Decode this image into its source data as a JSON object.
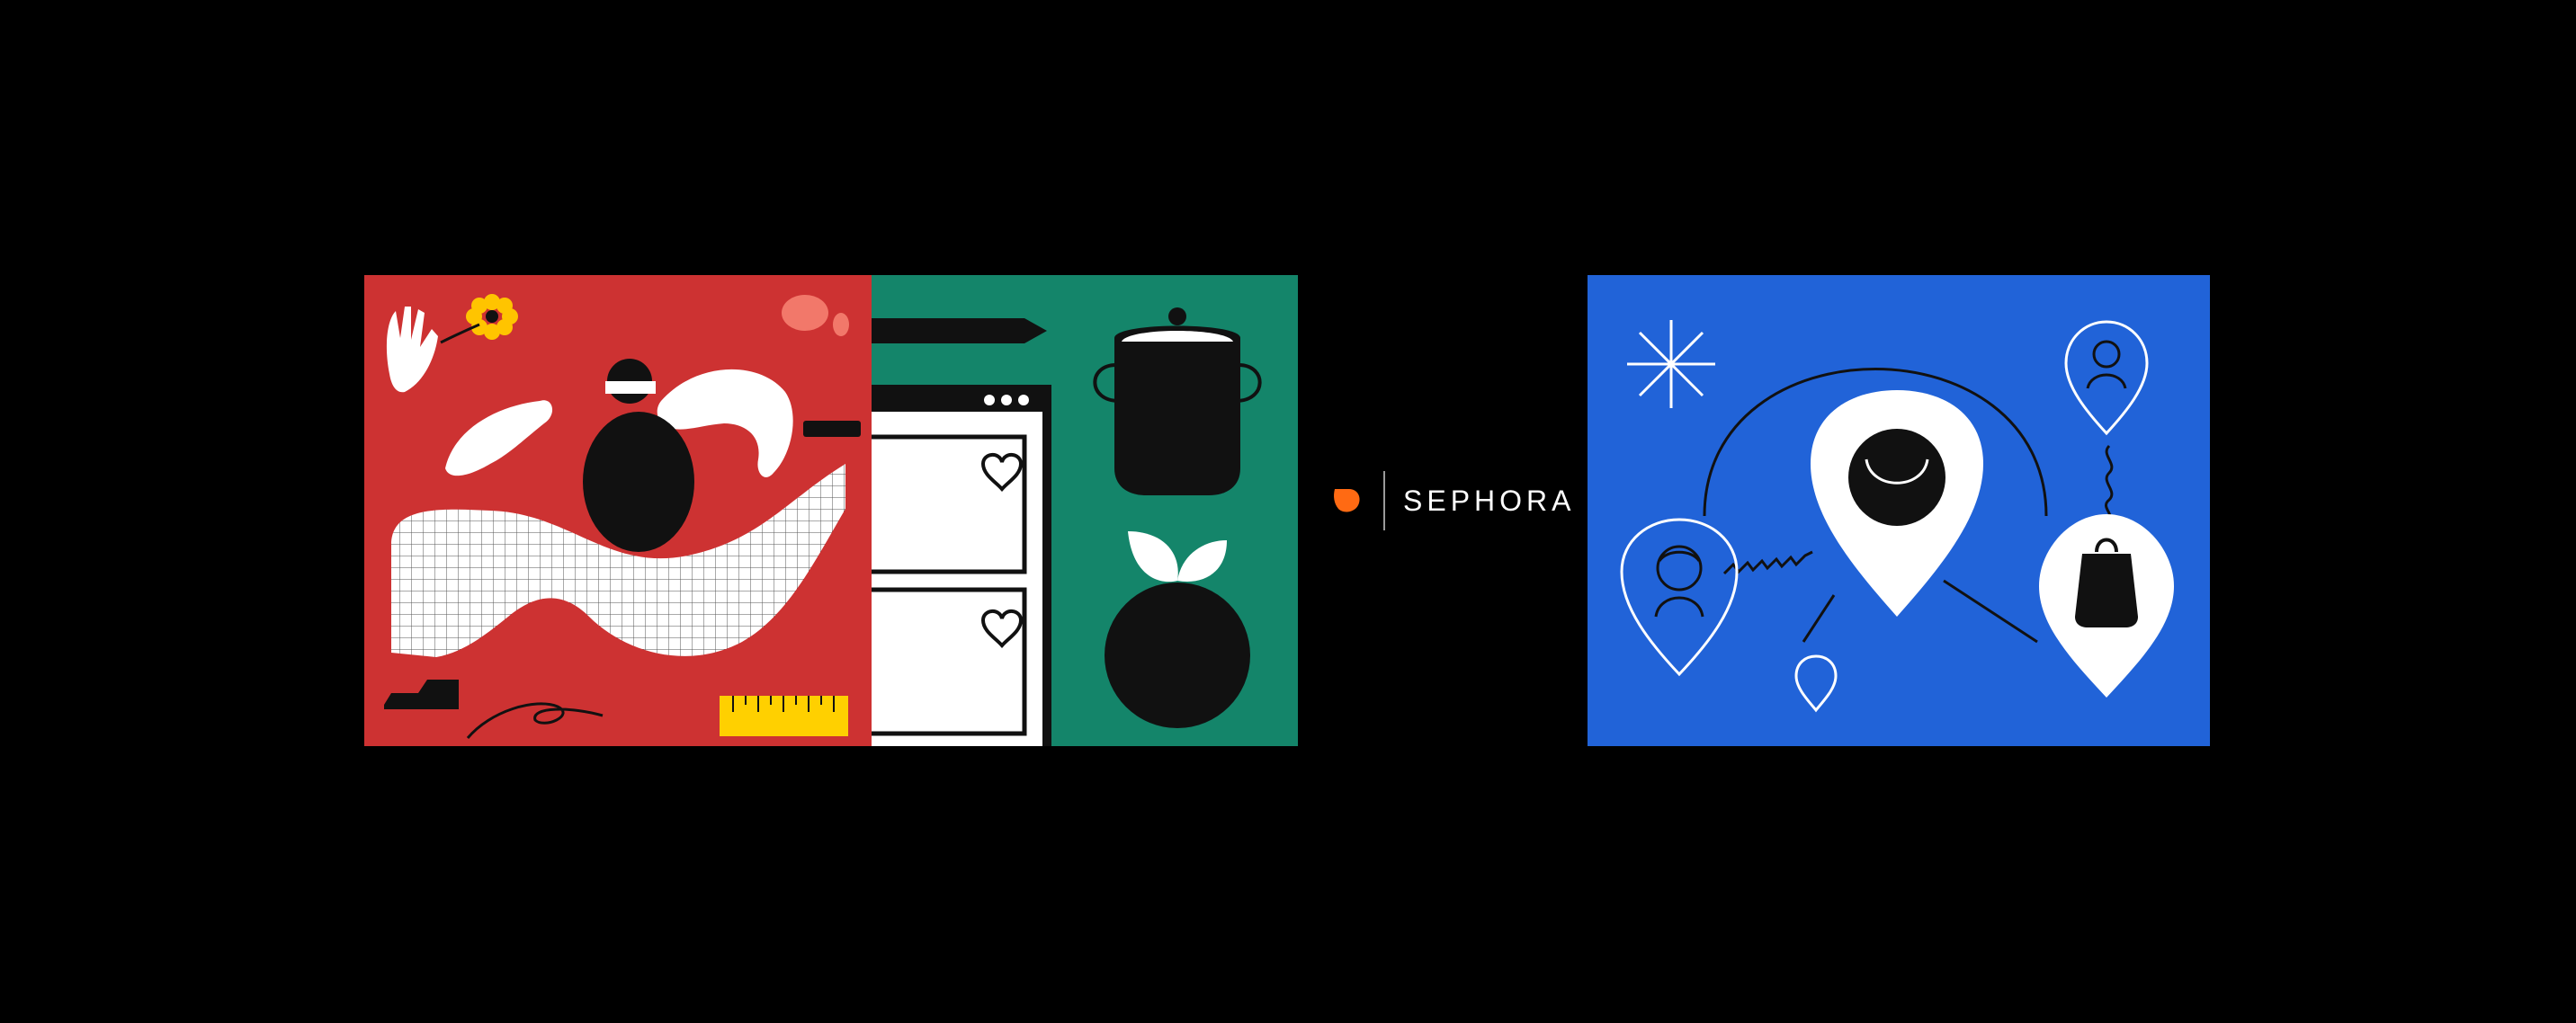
{
  "brand": {
    "wordmark": "SEPHORA",
    "logo_icon": "orange-leaf-mark",
    "accent_color": "#ff6a13"
  },
  "colors": {
    "background": "#000000",
    "panel_red": "#cd3232",
    "panel_green": "#14856a",
    "panel_blue": "#2163d8",
    "accent_yellow": "#ffd000",
    "accent_salmon": "#f2786a",
    "ink": "#111111",
    "paper": "#ffffff"
  },
  "illustrations": [
    {
      "icon": "dancing-figure-illustration"
    },
    {
      "icon": "wishlist-and-pot-illustration"
    },
    {
      "icon": "location-pins-network-illustration"
    }
  ]
}
